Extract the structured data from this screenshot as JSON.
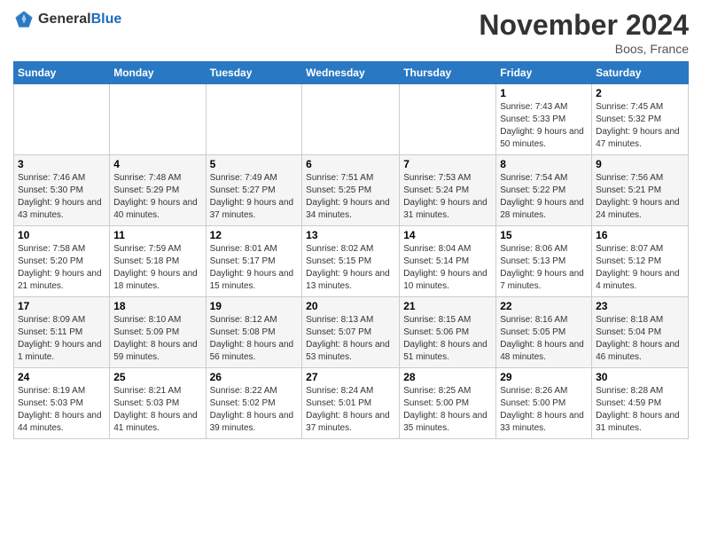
{
  "header": {
    "logo_general": "General",
    "logo_blue": "Blue",
    "title": "November 2024",
    "location": "Boos, France"
  },
  "weekdays": [
    "Sunday",
    "Monday",
    "Tuesday",
    "Wednesday",
    "Thursday",
    "Friday",
    "Saturday"
  ],
  "weeks": [
    [
      null,
      null,
      null,
      null,
      null,
      {
        "day": "1",
        "sunrise": "7:43 AM",
        "sunset": "5:33 PM",
        "daylight": "9 hours and 50 minutes."
      },
      {
        "day": "2",
        "sunrise": "7:45 AM",
        "sunset": "5:32 PM",
        "daylight": "9 hours and 47 minutes."
      }
    ],
    [
      {
        "day": "3",
        "sunrise": "7:46 AM",
        "sunset": "5:30 PM",
        "daylight": "9 hours and 43 minutes."
      },
      {
        "day": "4",
        "sunrise": "7:48 AM",
        "sunset": "5:29 PM",
        "daylight": "9 hours and 40 minutes."
      },
      {
        "day": "5",
        "sunrise": "7:49 AM",
        "sunset": "5:27 PM",
        "daylight": "9 hours and 37 minutes."
      },
      {
        "day": "6",
        "sunrise": "7:51 AM",
        "sunset": "5:25 PM",
        "daylight": "9 hours and 34 minutes."
      },
      {
        "day": "7",
        "sunrise": "7:53 AM",
        "sunset": "5:24 PM",
        "daylight": "9 hours and 31 minutes."
      },
      {
        "day": "8",
        "sunrise": "7:54 AM",
        "sunset": "5:22 PM",
        "daylight": "9 hours and 28 minutes."
      },
      {
        "day": "9",
        "sunrise": "7:56 AM",
        "sunset": "5:21 PM",
        "daylight": "9 hours and 24 minutes."
      }
    ],
    [
      {
        "day": "10",
        "sunrise": "7:58 AM",
        "sunset": "5:20 PM",
        "daylight": "9 hours and 21 minutes."
      },
      {
        "day": "11",
        "sunrise": "7:59 AM",
        "sunset": "5:18 PM",
        "daylight": "9 hours and 18 minutes."
      },
      {
        "day": "12",
        "sunrise": "8:01 AM",
        "sunset": "5:17 PM",
        "daylight": "9 hours and 15 minutes."
      },
      {
        "day": "13",
        "sunrise": "8:02 AM",
        "sunset": "5:15 PM",
        "daylight": "9 hours and 13 minutes."
      },
      {
        "day": "14",
        "sunrise": "8:04 AM",
        "sunset": "5:14 PM",
        "daylight": "9 hours and 10 minutes."
      },
      {
        "day": "15",
        "sunrise": "8:06 AM",
        "sunset": "5:13 PM",
        "daylight": "9 hours and 7 minutes."
      },
      {
        "day": "16",
        "sunrise": "8:07 AM",
        "sunset": "5:12 PM",
        "daylight": "9 hours and 4 minutes."
      }
    ],
    [
      {
        "day": "17",
        "sunrise": "8:09 AM",
        "sunset": "5:11 PM",
        "daylight": "9 hours and 1 minute."
      },
      {
        "day": "18",
        "sunrise": "8:10 AM",
        "sunset": "5:09 PM",
        "daylight": "8 hours and 59 minutes."
      },
      {
        "day": "19",
        "sunrise": "8:12 AM",
        "sunset": "5:08 PM",
        "daylight": "8 hours and 56 minutes."
      },
      {
        "day": "20",
        "sunrise": "8:13 AM",
        "sunset": "5:07 PM",
        "daylight": "8 hours and 53 minutes."
      },
      {
        "day": "21",
        "sunrise": "8:15 AM",
        "sunset": "5:06 PM",
        "daylight": "8 hours and 51 minutes."
      },
      {
        "day": "22",
        "sunrise": "8:16 AM",
        "sunset": "5:05 PM",
        "daylight": "8 hours and 48 minutes."
      },
      {
        "day": "23",
        "sunrise": "8:18 AM",
        "sunset": "5:04 PM",
        "daylight": "8 hours and 46 minutes."
      }
    ],
    [
      {
        "day": "24",
        "sunrise": "8:19 AM",
        "sunset": "5:03 PM",
        "daylight": "8 hours and 44 minutes."
      },
      {
        "day": "25",
        "sunrise": "8:21 AM",
        "sunset": "5:03 PM",
        "daylight": "8 hours and 41 minutes."
      },
      {
        "day": "26",
        "sunrise": "8:22 AM",
        "sunset": "5:02 PM",
        "daylight": "8 hours and 39 minutes."
      },
      {
        "day": "27",
        "sunrise": "8:24 AM",
        "sunset": "5:01 PM",
        "daylight": "8 hours and 37 minutes."
      },
      {
        "day": "28",
        "sunrise": "8:25 AM",
        "sunset": "5:00 PM",
        "daylight": "8 hours and 35 minutes."
      },
      {
        "day": "29",
        "sunrise": "8:26 AM",
        "sunset": "5:00 PM",
        "daylight": "8 hours and 33 minutes."
      },
      {
        "day": "30",
        "sunrise": "8:28 AM",
        "sunset": "4:59 PM",
        "daylight": "8 hours and 31 minutes."
      }
    ]
  ]
}
